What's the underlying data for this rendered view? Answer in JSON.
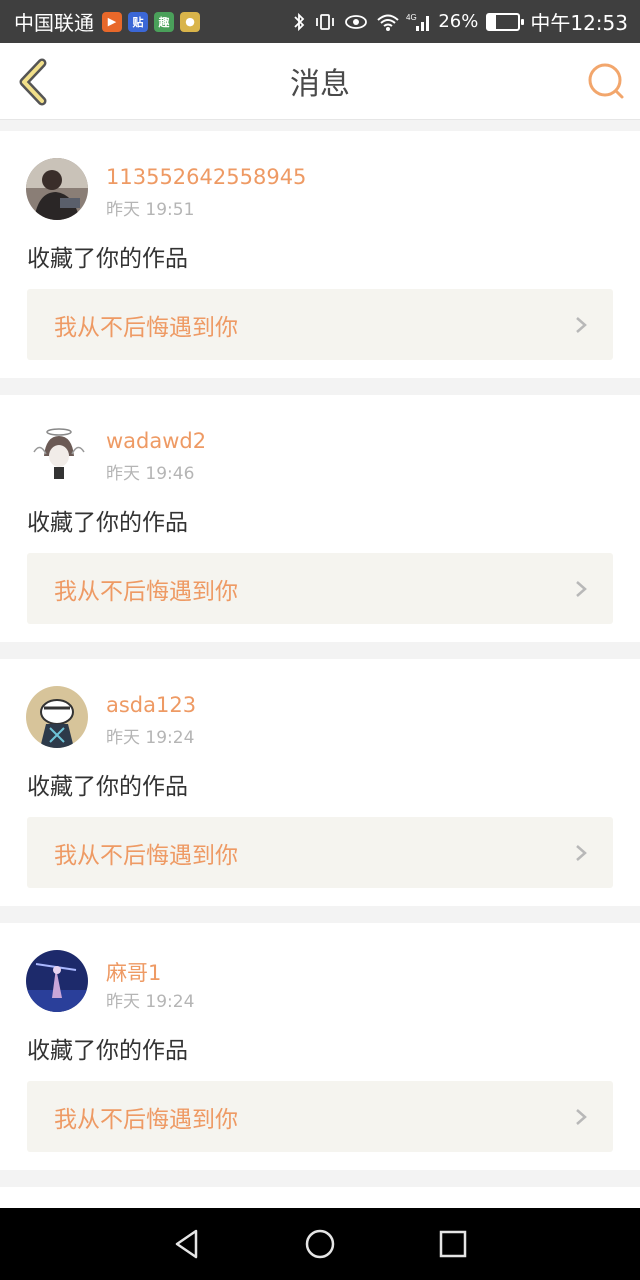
{
  "status_bar": {
    "carrier": "中国联通",
    "app_icons": [
      {
        "icon": "play-app-icon",
        "color": "#e8682a",
        "glyph": "▶"
      },
      {
        "icon": "tieba-app-icon",
        "color": "#3b67d6",
        "glyph": "贴"
      },
      {
        "icon": "news-app-icon",
        "color": "#4aa05a",
        "glyph": "趣"
      },
      {
        "icon": "chat-app-icon",
        "color": "#d9b44a",
        "glyph": "●"
      }
    ],
    "battery_percent": "26%",
    "battery_level": 0.26,
    "time": "中午12:53"
  },
  "header": {
    "title": "消息",
    "accent_color": "#f2a66c"
  },
  "messages": [
    {
      "username": "113552642558945",
      "time": "昨天 19:51",
      "action": "收藏了你的作品",
      "work_title": "我从不后悔遇到你",
      "avatar": "photo-avatar-person"
    },
    {
      "username": "wadawd2",
      "time": "昨天 19:46",
      "action": "收藏了你的作品",
      "work_title": "我从不后悔遇到你",
      "avatar": "anime-angel-avatar"
    },
    {
      "username": "asda123",
      "time": "昨天 19:24",
      "action": "收藏了你的作品",
      "work_title": "我从不后悔遇到你",
      "avatar": "anime-character-avatar"
    },
    {
      "username": "麻哥1",
      "time": "昨天 19:24",
      "action": "收藏了你的作品",
      "work_title": "我从不后悔遇到你",
      "avatar": "night-scene-avatar"
    }
  ]
}
